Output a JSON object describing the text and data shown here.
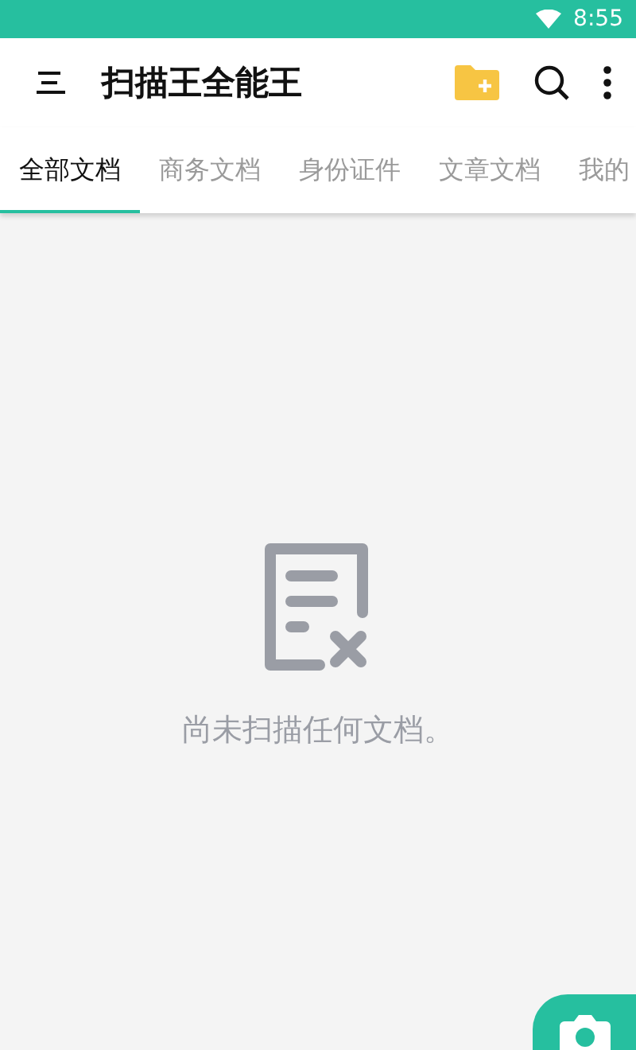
{
  "status_bar": {
    "time": "8:55"
  },
  "toolbar": {
    "title": "扫描王全能王"
  },
  "tabs": [
    {
      "label": "全部文档",
      "selected": true
    },
    {
      "label": "商务文档",
      "selected": false
    },
    {
      "label": "身份证件",
      "selected": false
    },
    {
      "label": "文章文档",
      "selected": false
    },
    {
      "label": "我的",
      "selected": false
    }
  ],
  "empty_state": {
    "message": "尚未扫描任何文档。"
  }
}
